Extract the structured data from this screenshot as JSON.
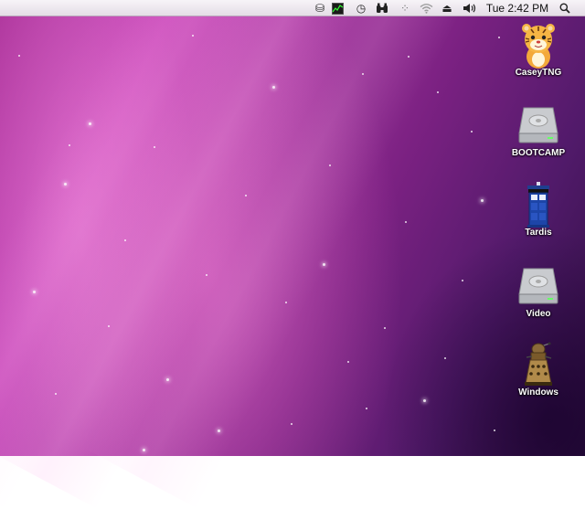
{
  "menubar": {
    "status_icons": [
      {
        "name": "script-menu-icon",
        "glyph": "⛁"
      },
      {
        "name": "activity-monitor-icon",
        "glyph": "▤"
      },
      {
        "name": "time-machine-icon",
        "glyph": "◷"
      },
      {
        "name": "binoculars-icon",
        "glyph": "✇"
      },
      {
        "name": "spaces-icon",
        "glyph": "⁘"
      },
      {
        "name": "wifi-icon",
        "glyph": "◠"
      },
      {
        "name": "eject-icon",
        "glyph": "⏏"
      },
      {
        "name": "volume-icon",
        "glyph": "◀)"
      }
    ],
    "clock": "Tue 2:42 PM",
    "spotlight_glyph": "⚲"
  },
  "desktop": {
    "icons": [
      {
        "label": "CaseyTNG",
        "icon": "tiger-icon"
      },
      {
        "label": "BOOTCAMP",
        "icon": "hard-drive-icon"
      },
      {
        "label": "Tardis",
        "icon": "police-box-icon"
      },
      {
        "label": "Video",
        "icon": "hard-drive-icon"
      },
      {
        "label": "Windows",
        "icon": "dalek-icon"
      }
    ]
  }
}
